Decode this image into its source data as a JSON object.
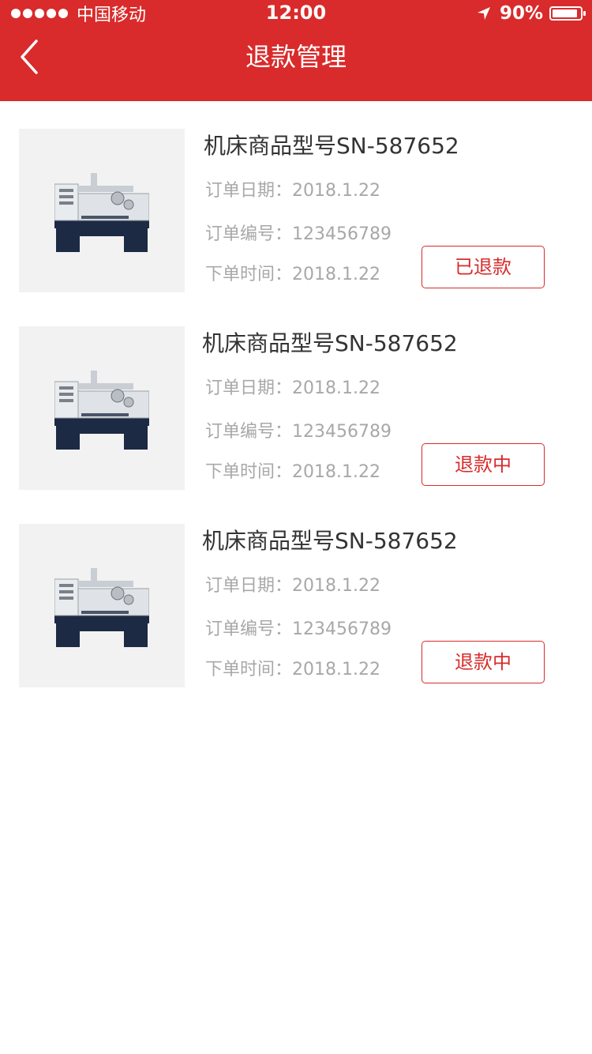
{
  "status_bar": {
    "carrier": "中国移动",
    "time": "12:00",
    "battery_percent": "90%",
    "battery_level": 0.9
  },
  "nav": {
    "title": "退款管理",
    "back_icon": "chevron-left-icon"
  },
  "colors": {
    "brand_red": "#d92b2b",
    "meta_gray": "#a8a8a8",
    "title_dark": "#333333",
    "thumb_bg": "#f2f2f2"
  },
  "orders": [
    {
      "title": "机床商品型号SN-587652",
      "date_label": "订单日期：",
      "date": "2018.1.22",
      "number_label": "订单编号：",
      "number": "123456789",
      "time_label": "下单时间：",
      "time": "2018.1.22",
      "status": "已退款"
    },
    {
      "title": "机床商品型号SN-587652",
      "date_label": "订单日期：",
      "date": "2018.1.22",
      "number_label": "订单编号：",
      "number": "123456789",
      "time_label": "下单时间：",
      "time": "2018.1.22",
      "status": "退款中"
    },
    {
      "title": "机床商品型号SN-587652",
      "date_label": "订单日期：",
      "date": "2018.1.22",
      "number_label": "订单编号：",
      "number": "123456789",
      "time_label": "下单时间：",
      "time": "2018.1.22",
      "status": "退款中"
    }
  ]
}
